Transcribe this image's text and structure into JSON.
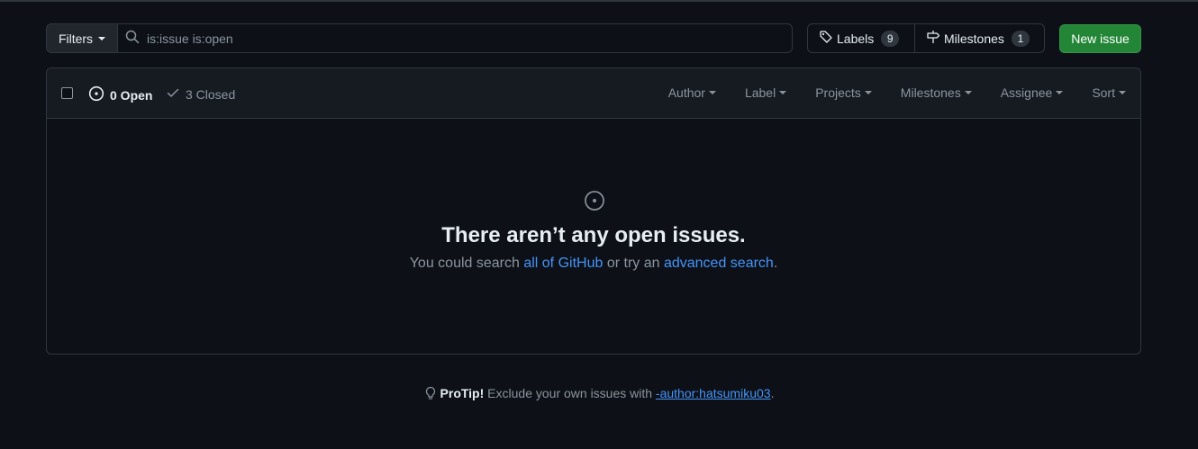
{
  "subnav": {
    "filters_label": "Filters",
    "search_value": "is:issue is:open",
    "labels_label": "Labels",
    "labels_count": "9",
    "milestones_label": "Milestones",
    "milestones_count": "1",
    "new_issue_label": "New issue"
  },
  "header": {
    "open_label": "0 Open",
    "closed_label": "3 Closed",
    "filters": [
      "Author",
      "Label",
      "Projects",
      "Milestones",
      "Assignee",
      "Sort"
    ]
  },
  "blankslate": {
    "title": "There aren’t any open issues.",
    "text_prefix": "You could search ",
    "link1": "all of GitHub",
    "text_middle": " or try an ",
    "link2": "advanced search",
    "text_suffix": "."
  },
  "protip": {
    "label": "ProTip!",
    "text": " Exclude your own issues with ",
    "link": "-author:hatsumiku03",
    "suffix": "."
  },
  "colors": {
    "background": "#0d1117",
    "accent_link": "#4493f8",
    "primary_button": "#238636"
  }
}
